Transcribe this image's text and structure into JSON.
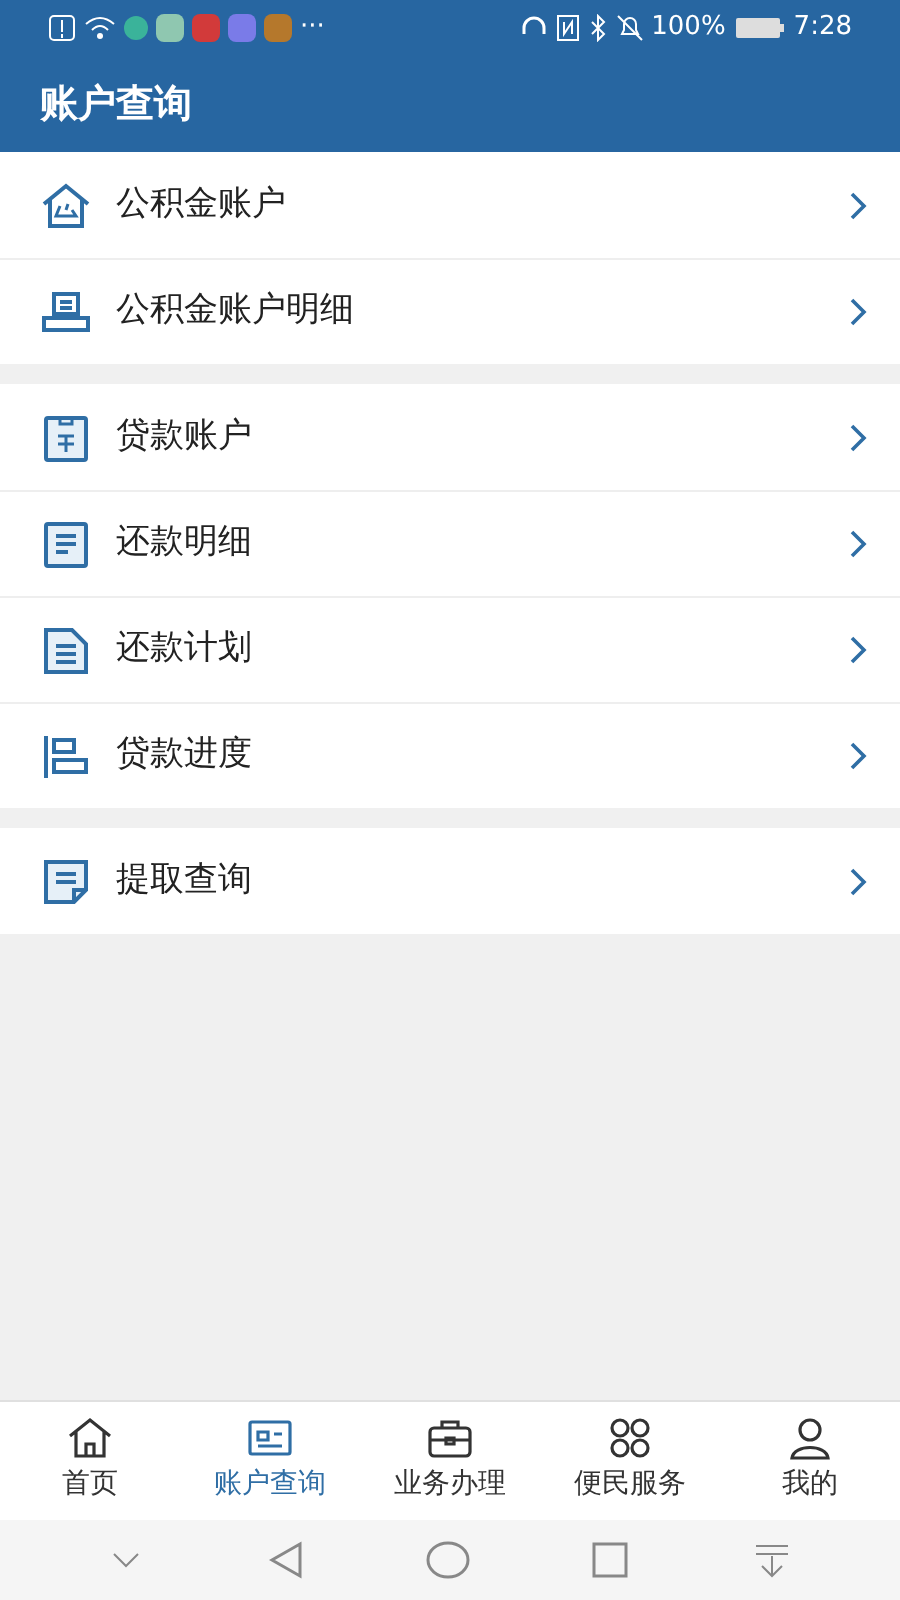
{
  "status_bar": {
    "overflow": "···",
    "battery": "100%",
    "time": "7:28"
  },
  "header": {
    "title": "账户查询"
  },
  "groups": [
    {
      "items": [
        {
          "label": "公积金账户"
        },
        {
          "label": "公积金账户明细"
        }
      ]
    },
    {
      "items": [
        {
          "label": "贷款账户"
        },
        {
          "label": "还款明细"
        },
        {
          "label": "还款计划"
        },
        {
          "label": "贷款进度"
        }
      ]
    },
    {
      "items": [
        {
          "label": "提取查询"
        }
      ]
    }
  ],
  "tabs": [
    {
      "label": "首页",
      "selected": false
    },
    {
      "label": "账户查询",
      "selected": true
    },
    {
      "label": "业务办理",
      "selected": false
    },
    {
      "label": "便民服务",
      "selected": false
    },
    {
      "label": "我的",
      "selected": false
    }
  ]
}
